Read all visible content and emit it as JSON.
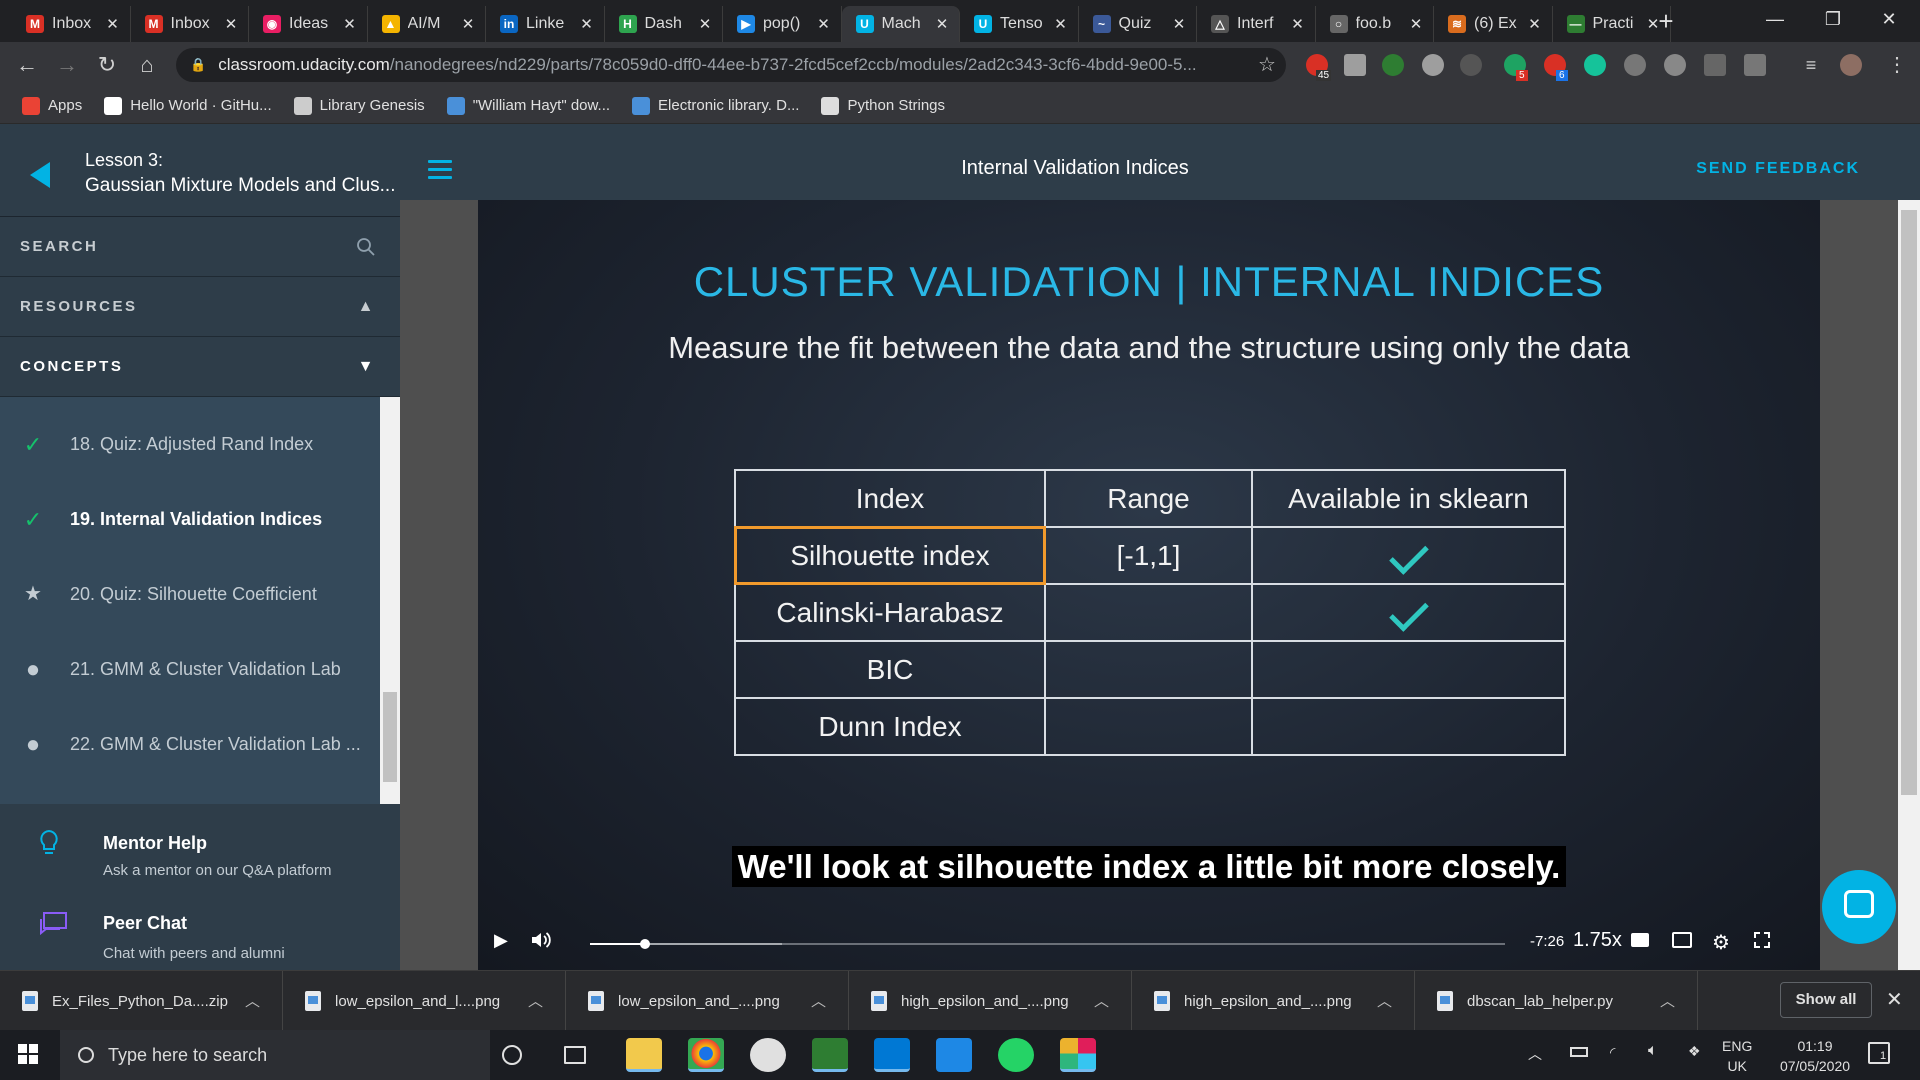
{
  "browser": {
    "tabs": [
      {
        "title": "Inbox",
        "fav_color": "#d93025",
        "glyph": "M"
      },
      {
        "title": "Inbox",
        "fav_color": "#d93025",
        "glyph": "M"
      },
      {
        "title": "Ideas",
        "fav_color": "#e91e63",
        "glyph": "◉"
      },
      {
        "title": "AI/M",
        "fav_color": "#f4b400",
        "glyph": "▲"
      },
      {
        "title": "Linke",
        "fav_color": "#0a66c2",
        "glyph": "in"
      },
      {
        "title": "Dash",
        "fav_color": "#2ea44f",
        "glyph": "H"
      },
      {
        "title": "pop()",
        "fav_color": "#1e88e5",
        "glyph": "▶"
      },
      {
        "title": "Mach",
        "fav_color": "#02b3e4",
        "glyph": "U"
      },
      {
        "title": "Tenso",
        "fav_color": "#02b3e4",
        "glyph": "U"
      },
      {
        "title": "Quiz",
        "fav_color": "#3b5998",
        "glyph": "~"
      },
      {
        "title": "Interf",
        "fav_color": "#555555",
        "glyph": "△"
      },
      {
        "title": "foo.b",
        "fav_color": "#666666",
        "glyph": "○"
      },
      {
        "title": "(6) Ex",
        "fav_color": "#d96c1e",
        "glyph": "≋"
      },
      {
        "title": "Practi",
        "fav_color": "#2e7d32",
        "glyph": "—"
      }
    ],
    "active_tab_index": 7,
    "address": {
      "domain": "classroom.udacity.com",
      "path": "/nanodegrees/nd229/parts/78c059d0-dff0-44ee-b737-2fcd5cef2ccb/modules/2ad2c343-3cf6-4bdd-9e00-5..."
    },
    "extension_badges": [
      "45",
      "5",
      "6"
    ],
    "bookmarks": [
      {
        "label": "Apps",
        "color": "#ea4335"
      },
      {
        "label": "Hello World · GitHu...",
        "color": "#ffffff"
      },
      {
        "label": "Library Genesis",
        "color": "#cccccc"
      },
      {
        "label": "\"William Hayt\" dow...",
        "color": "#4a90d9"
      },
      {
        "label": "Electronic library. D...",
        "color": "#4a90d9"
      },
      {
        "label": "Python Strings",
        "color": "#dddddd"
      }
    ]
  },
  "lesson": {
    "number": "Lesson 3:",
    "name": "Gaussian Mixture Models and Clus..."
  },
  "header": {
    "concept_title": "Internal Validation Indices",
    "feedback_label": "SEND FEEDBACK"
  },
  "sidebar": {
    "search_label": "SEARCH",
    "resources_label": "RESOURCES",
    "concepts_label": "CONCEPTS",
    "concepts": [
      {
        "label": "18. Quiz: Adjusted Rand Index",
        "status": "check"
      },
      {
        "label": "19. Internal Validation Indices",
        "status": "check",
        "current": true
      },
      {
        "label": "20. Quiz: Silhouette Coefficient",
        "status": "star"
      },
      {
        "label": "21. GMM & Cluster Validation Lab",
        "status": "dot"
      },
      {
        "label": "22. GMM & Cluster Validation Lab ...",
        "status": "dot"
      }
    ],
    "help": [
      {
        "title": "Mentor Help",
        "subtitle": "Ask a mentor on our Q&A platform",
        "icon": "lightbulb-icon"
      },
      {
        "title": "Peer Chat",
        "subtitle": "Chat with peers and alumni",
        "icon": "chat-icon"
      }
    ]
  },
  "slide": {
    "title": "CLUSTER VALIDATION | INTERNAL INDICES",
    "subtitle": "Measure the fit between the data and the structure using only the data",
    "table": {
      "headers": [
        "Index",
        "Range",
        "Available in sklearn"
      ],
      "rows": [
        {
          "index": "Silhouette index",
          "range": "[-1,1]",
          "sklearn": true,
          "highlighted": true
        },
        {
          "index": "Calinski-Harabasz",
          "range": "",
          "sklearn": true
        },
        {
          "index": "BIC",
          "range": "",
          "sklearn": false
        },
        {
          "index": "Dunn Index",
          "range": "",
          "sklearn": false
        }
      ]
    },
    "caption": "We'll look at silhouette index a little bit more closely."
  },
  "player": {
    "time_remaining": "-7:26",
    "speed": "1.75x",
    "progress": 0.06,
    "buffered": 0.21
  },
  "downloads": {
    "items": [
      "Ex_Files_Python_Da....zip",
      "low_epsilon_and_l....png",
      "low_epsilon_and_....png",
      "high_epsilon_and_....png",
      "high_epsilon_and_....png",
      "dbscan_lab_helper.py"
    ],
    "show_all_label": "Show all"
  },
  "taskbar": {
    "search_placeholder": "Type here to search",
    "lang_top": "ENG",
    "lang_bottom": "UK",
    "time": "01:19",
    "date": "07/05/2020",
    "notification_count": "1"
  }
}
